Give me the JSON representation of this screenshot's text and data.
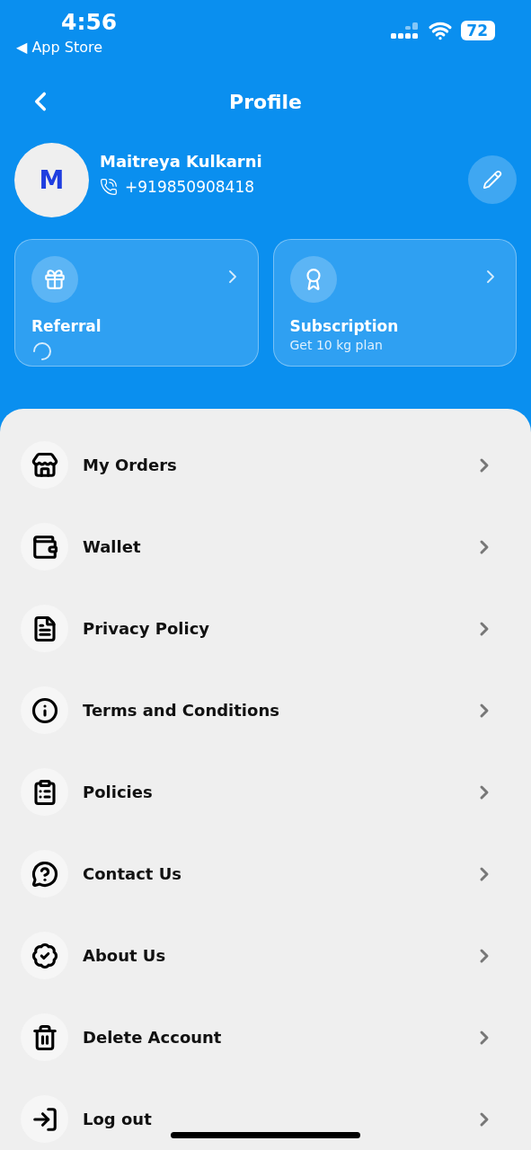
{
  "status_bar": {
    "time": "4:56",
    "back_arrow": "◀",
    "back_label": "App Store",
    "battery": "72"
  },
  "header": {
    "title": "Profile"
  },
  "profile": {
    "initial": "M",
    "name": "Maitreya Kulkarni",
    "phone": "+919850908418"
  },
  "cards": [
    {
      "kind": "referral",
      "title": "Referral",
      "loading": true
    },
    {
      "kind": "subscription",
      "title": "Subscription",
      "subtitle": "Get 10 kg plan",
      "loading": false
    }
  ],
  "menu": [
    {
      "kind": "orders",
      "label": "My Orders"
    },
    {
      "kind": "wallet",
      "label": "Wallet"
    },
    {
      "kind": "privacy",
      "label": "Privacy Policy"
    },
    {
      "kind": "terms",
      "label": "Terms and Conditions"
    },
    {
      "kind": "policies",
      "label": "Policies"
    },
    {
      "kind": "contact",
      "label": "Contact Us"
    },
    {
      "kind": "about",
      "label": "About Us"
    },
    {
      "kind": "delete",
      "label": "Delete Account"
    },
    {
      "kind": "logout",
      "label": "Log out"
    }
  ]
}
